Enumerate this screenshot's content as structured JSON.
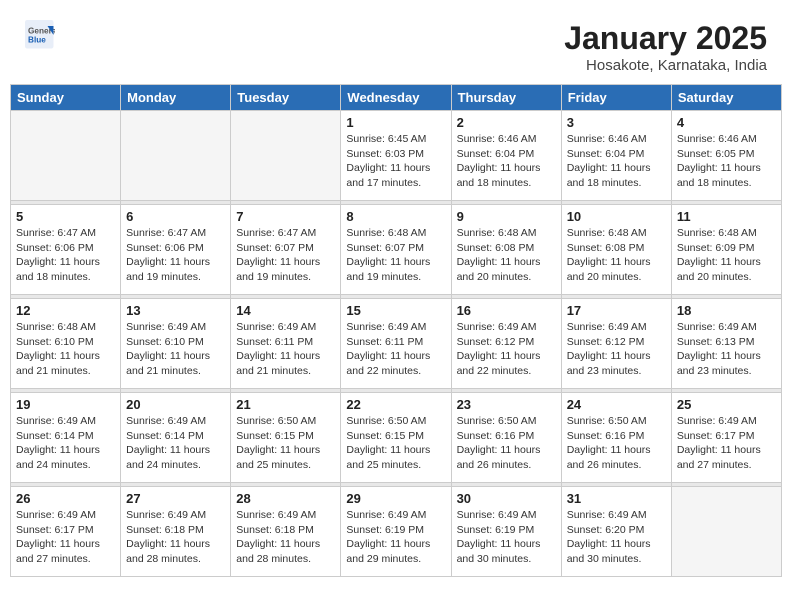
{
  "header": {
    "logo_general": "General",
    "logo_blue": "Blue",
    "month": "January 2025",
    "location": "Hosakote, Karnataka, India"
  },
  "weekdays": [
    "Sunday",
    "Monday",
    "Tuesday",
    "Wednesday",
    "Thursday",
    "Friday",
    "Saturday"
  ],
  "weeks": [
    [
      {
        "day": "",
        "info": ""
      },
      {
        "day": "",
        "info": ""
      },
      {
        "day": "",
        "info": ""
      },
      {
        "day": "1",
        "info": "Sunrise: 6:45 AM\nSunset: 6:03 PM\nDaylight: 11 hours\nand 17 minutes."
      },
      {
        "day": "2",
        "info": "Sunrise: 6:46 AM\nSunset: 6:04 PM\nDaylight: 11 hours\nand 18 minutes."
      },
      {
        "day": "3",
        "info": "Sunrise: 6:46 AM\nSunset: 6:04 PM\nDaylight: 11 hours\nand 18 minutes."
      },
      {
        "day": "4",
        "info": "Sunrise: 6:46 AM\nSunset: 6:05 PM\nDaylight: 11 hours\nand 18 minutes."
      }
    ],
    [
      {
        "day": "5",
        "info": "Sunrise: 6:47 AM\nSunset: 6:06 PM\nDaylight: 11 hours\nand 18 minutes."
      },
      {
        "day": "6",
        "info": "Sunrise: 6:47 AM\nSunset: 6:06 PM\nDaylight: 11 hours\nand 19 minutes."
      },
      {
        "day": "7",
        "info": "Sunrise: 6:47 AM\nSunset: 6:07 PM\nDaylight: 11 hours\nand 19 minutes."
      },
      {
        "day": "8",
        "info": "Sunrise: 6:48 AM\nSunset: 6:07 PM\nDaylight: 11 hours\nand 19 minutes."
      },
      {
        "day": "9",
        "info": "Sunrise: 6:48 AM\nSunset: 6:08 PM\nDaylight: 11 hours\nand 20 minutes."
      },
      {
        "day": "10",
        "info": "Sunrise: 6:48 AM\nSunset: 6:08 PM\nDaylight: 11 hours\nand 20 minutes."
      },
      {
        "day": "11",
        "info": "Sunrise: 6:48 AM\nSunset: 6:09 PM\nDaylight: 11 hours\nand 20 minutes."
      }
    ],
    [
      {
        "day": "12",
        "info": "Sunrise: 6:48 AM\nSunset: 6:10 PM\nDaylight: 11 hours\nand 21 minutes."
      },
      {
        "day": "13",
        "info": "Sunrise: 6:49 AM\nSunset: 6:10 PM\nDaylight: 11 hours\nand 21 minutes."
      },
      {
        "day": "14",
        "info": "Sunrise: 6:49 AM\nSunset: 6:11 PM\nDaylight: 11 hours\nand 21 minutes."
      },
      {
        "day": "15",
        "info": "Sunrise: 6:49 AM\nSunset: 6:11 PM\nDaylight: 11 hours\nand 22 minutes."
      },
      {
        "day": "16",
        "info": "Sunrise: 6:49 AM\nSunset: 6:12 PM\nDaylight: 11 hours\nand 22 minutes."
      },
      {
        "day": "17",
        "info": "Sunrise: 6:49 AM\nSunset: 6:12 PM\nDaylight: 11 hours\nand 23 minutes."
      },
      {
        "day": "18",
        "info": "Sunrise: 6:49 AM\nSunset: 6:13 PM\nDaylight: 11 hours\nand 23 minutes."
      }
    ],
    [
      {
        "day": "19",
        "info": "Sunrise: 6:49 AM\nSunset: 6:14 PM\nDaylight: 11 hours\nand 24 minutes."
      },
      {
        "day": "20",
        "info": "Sunrise: 6:49 AM\nSunset: 6:14 PM\nDaylight: 11 hours\nand 24 minutes."
      },
      {
        "day": "21",
        "info": "Sunrise: 6:50 AM\nSunset: 6:15 PM\nDaylight: 11 hours\nand 25 minutes."
      },
      {
        "day": "22",
        "info": "Sunrise: 6:50 AM\nSunset: 6:15 PM\nDaylight: 11 hours\nand 25 minutes."
      },
      {
        "day": "23",
        "info": "Sunrise: 6:50 AM\nSunset: 6:16 PM\nDaylight: 11 hours\nand 26 minutes."
      },
      {
        "day": "24",
        "info": "Sunrise: 6:50 AM\nSunset: 6:16 PM\nDaylight: 11 hours\nand 26 minutes."
      },
      {
        "day": "25",
        "info": "Sunrise: 6:49 AM\nSunset: 6:17 PM\nDaylight: 11 hours\nand 27 minutes."
      }
    ],
    [
      {
        "day": "26",
        "info": "Sunrise: 6:49 AM\nSunset: 6:17 PM\nDaylight: 11 hours\nand 27 minutes."
      },
      {
        "day": "27",
        "info": "Sunrise: 6:49 AM\nSunset: 6:18 PM\nDaylight: 11 hours\nand 28 minutes."
      },
      {
        "day": "28",
        "info": "Sunrise: 6:49 AM\nSunset: 6:18 PM\nDaylight: 11 hours\nand 28 minutes."
      },
      {
        "day": "29",
        "info": "Sunrise: 6:49 AM\nSunset: 6:19 PM\nDaylight: 11 hours\nand 29 minutes."
      },
      {
        "day": "30",
        "info": "Sunrise: 6:49 AM\nSunset: 6:19 PM\nDaylight: 11 hours\nand 30 minutes."
      },
      {
        "day": "31",
        "info": "Sunrise: 6:49 AM\nSunset: 6:20 PM\nDaylight: 11 hours\nand 30 minutes."
      },
      {
        "day": "",
        "info": ""
      }
    ]
  ]
}
